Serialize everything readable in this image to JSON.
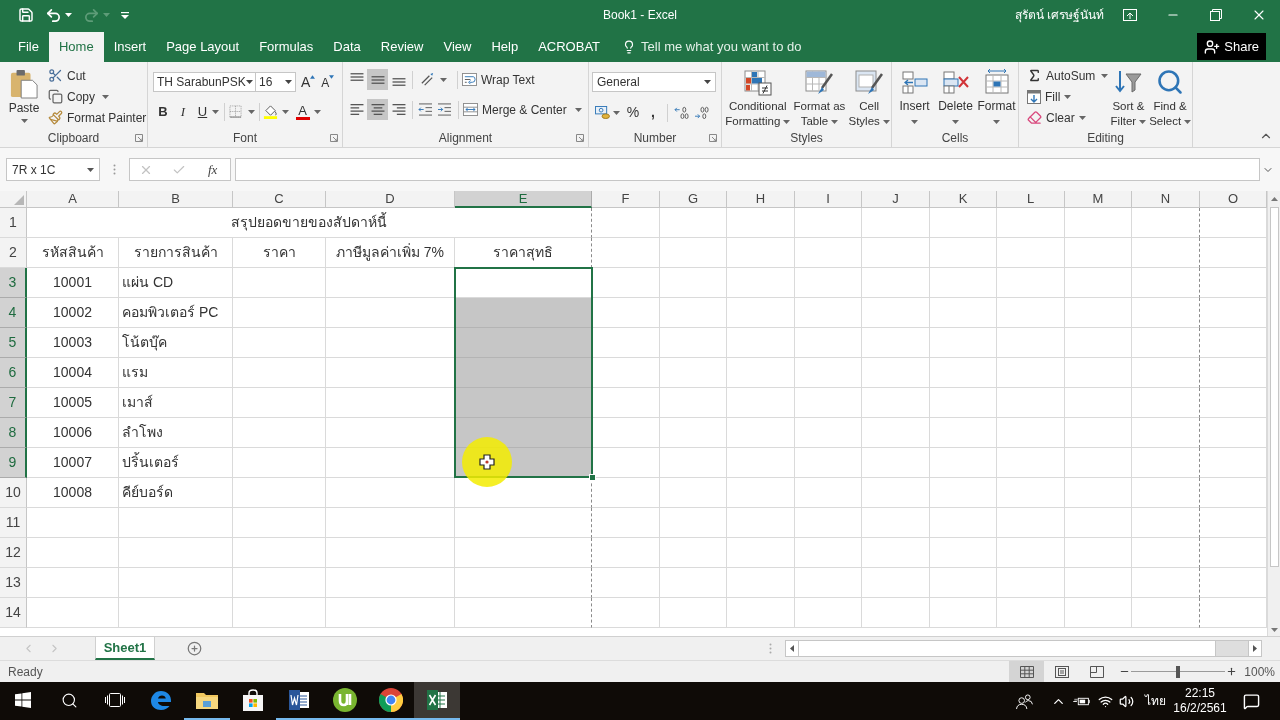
{
  "title_bar": {
    "quick_access": [
      {
        "kind": "save",
        "disabled": false
      },
      {
        "kind": "undo",
        "disabled": false
      },
      {
        "kind": "redo",
        "disabled": true
      },
      {
        "kind": "customize",
        "disabled": false
      }
    ],
    "title": "Book1 - Excel",
    "user": "สุรัตน์ เศรษฐ์นันท์"
  },
  "ribbon_tabs": [
    {
      "label": "File",
      "selected": false
    },
    {
      "label": "Home",
      "selected": true
    },
    {
      "label": "Insert",
      "selected": false
    },
    {
      "label": "Page Layout",
      "selected": false
    },
    {
      "label": "Formulas",
      "selected": false
    },
    {
      "label": "Data",
      "selected": false
    },
    {
      "label": "Review",
      "selected": false
    },
    {
      "label": "View",
      "selected": false
    },
    {
      "label": "Help",
      "selected": false
    },
    {
      "label": "ACROBAT",
      "selected": false
    }
  ],
  "tell_me": {
    "placeholder": "Tell me what you want to do"
  },
  "share_button": "Share",
  "ribbon": {
    "clipboard": {
      "label": "Clipboard",
      "paste": "Paste",
      "cut": "Cut",
      "copy": "Copy",
      "format_painter": "Format Painter"
    },
    "font": {
      "label": "Font",
      "font_name": "TH SarabunPSK",
      "font_size": "16",
      "grow_font": "A",
      "shrink_font": "A",
      "bold": "B",
      "italic": "I",
      "underline": "U",
      "font_color": "A"
    },
    "alignment": {
      "label": "Alignment",
      "vertical": [
        {
          "kind": "top",
          "selected": false
        },
        {
          "kind": "middle",
          "selected": true
        },
        {
          "kind": "bottom",
          "selected": false
        }
      ],
      "horizontal": [
        {
          "kind": "left",
          "selected": false
        },
        {
          "kind": "center",
          "selected": true
        },
        {
          "kind": "right",
          "selected": false
        }
      ],
      "wrap_text": "Wrap Text",
      "merge_center": "Merge & Center"
    },
    "number": {
      "label": "Number",
      "format": "General",
      "percent": "%",
      "comma": ","
    },
    "styles": {
      "label": "Styles",
      "buttons": [
        {
          "kind": "conditional",
          "label": "Conditional Formatting"
        },
        {
          "kind": "table",
          "label": "Format as Table"
        },
        {
          "kind": "cell_styles",
          "label": "Cell Styles"
        }
      ]
    },
    "cells": {
      "label": "Cells",
      "buttons": [
        {
          "kind": "insert",
          "label": "Insert"
        },
        {
          "kind": "delete",
          "label": "Delete"
        },
        {
          "kind": "format",
          "label": "Format"
        }
      ]
    },
    "editing": {
      "label": "Editing",
      "autosum": "AutoSum",
      "fill": "Fill",
      "clear": "Clear",
      "sort_filter": "Sort & Filter",
      "find_select": "Find & Select"
    }
  },
  "formula_bar": {
    "name_box": "7R x 1C",
    "cancel": {
      "disabled": true
    },
    "enter": {
      "disabled": true
    },
    "function": "fx"
  },
  "sheet": {
    "columns": [
      {
        "label": "A",
        "selected": false
      },
      {
        "label": "B",
        "selected": false
      },
      {
        "label": "C",
        "selected": false
      },
      {
        "label": "D",
        "selected": false
      },
      {
        "label": "E",
        "selected": true
      },
      {
        "label": "F",
        "selected": false
      },
      {
        "label": "G",
        "selected": false
      },
      {
        "label": "H",
        "selected": false
      },
      {
        "label": "I",
        "selected": false
      },
      {
        "label": "J",
        "selected": false
      },
      {
        "label": "K",
        "selected": false
      },
      {
        "label": "L",
        "selected": false
      },
      {
        "label": "M",
        "selected": false
      },
      {
        "label": "N",
        "selected": false
      },
      {
        "label": "O",
        "selected": false
      }
    ],
    "rows": [
      {
        "label": "1",
        "kind": "title",
        "selected": false,
        "active": false,
        "cells": [
          "สรุปยอดขายของสัปดาห์นี้"
        ]
      },
      {
        "label": "2",
        "kind": "header",
        "selected": false,
        "active": false,
        "cells": [
          "รหัสสินค้า",
          "รายการสินค้า",
          "ราคา",
          "ภาษีมูลค่าเพิ่ม 7%",
          "ราคาสุทธิ"
        ]
      },
      {
        "label": "3",
        "kind": "data",
        "selected": true,
        "active": true,
        "cells": [
          "10001",
          "แผ่น CD"
        ]
      },
      {
        "label": "4",
        "kind": "data",
        "selected": true,
        "active": false,
        "cells": [
          "10002",
          "คอมพิวเตอร์ PC"
        ]
      },
      {
        "label": "5",
        "kind": "data",
        "selected": true,
        "active": false,
        "cells": [
          "10003",
          "โน้ตบุ๊ค"
        ]
      },
      {
        "label": "6",
        "kind": "data",
        "selected": true,
        "active": false,
        "cells": [
          "10004",
          "แรม"
        ]
      },
      {
        "label": "7",
        "kind": "data",
        "selected": true,
        "active": false,
        "cells": [
          "10005",
          "เมาส์"
        ]
      },
      {
        "label": "8",
        "kind": "data",
        "selected": true,
        "active": false,
        "cells": [
          "10006",
          "ลำโพง"
        ]
      },
      {
        "label": "9",
        "kind": "data",
        "selected": true,
        "active": false,
        "cells": [
          "10007",
          "ปริ้นเตอร์"
        ]
      },
      {
        "label": "10",
        "kind": "data",
        "selected": false,
        "active": false,
        "cells": [
          "10008",
          "คีย์บอร์ด"
        ]
      },
      {
        "label": "11",
        "kind": "empty",
        "selected": false,
        "active": false
      },
      {
        "label": "12",
        "kind": "empty",
        "selected": false,
        "active": false
      },
      {
        "label": "13",
        "kind": "empty",
        "selected": false,
        "active": false
      },
      {
        "label": "14",
        "kind": "empty",
        "selected": false,
        "active": false
      }
    ]
  },
  "sheet_tabs": {
    "nav": [
      {
        "kind": "previous",
        "disabled": true
      },
      {
        "kind": "next",
        "disabled": true
      }
    ],
    "tabs": [
      {
        "label": "Sheet1",
        "selected": true
      }
    ]
  },
  "status_bar": {
    "status": "Ready",
    "views": [
      {
        "kind": "normal",
        "selected": true
      },
      {
        "kind": "page_layout",
        "selected": false
      },
      {
        "kind": "page_break",
        "selected": false
      }
    ],
    "zoom": {
      "level": 0.5,
      "reading": "100%"
    }
  },
  "taskbar": {
    "apps": [
      {
        "kind": "start",
        "running": false,
        "active": false
      },
      {
        "kind": "search",
        "running": false,
        "active": false
      },
      {
        "kind": "task_view",
        "running": false,
        "active": false
      },
      {
        "kind": "edge",
        "running": false,
        "active": false
      },
      {
        "kind": "explorer",
        "running": true,
        "active": false
      },
      {
        "kind": "store",
        "running": false,
        "active": false
      },
      {
        "kind": "word",
        "running": true,
        "active": false
      },
      {
        "kind": "torrent",
        "running": true,
        "active": false
      },
      {
        "kind": "chrome",
        "running": true,
        "active": false
      },
      {
        "kind": "excel",
        "running": true,
        "active": true
      }
    ],
    "language": "ไทย",
    "time": "22:15",
    "date": "16/2/2561"
  }
}
